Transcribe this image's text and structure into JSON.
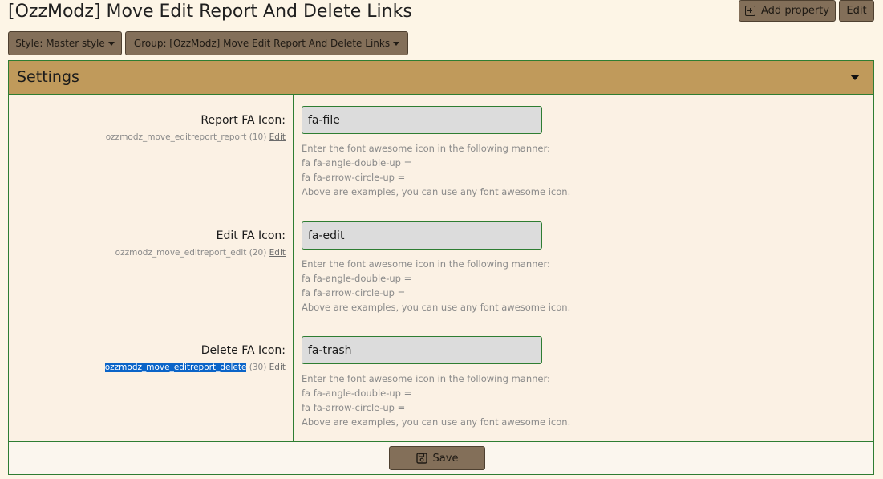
{
  "page": {
    "title": "[OzzModz] Move Edit Report And Delete Links"
  },
  "toolbar": {
    "add_property_label": "Add property",
    "add_property_icon": "plus-square-icon",
    "edit_label": "Edit"
  },
  "filters": {
    "style_label": "Style: Master style",
    "group_label": "Group: [OzzModz] Move Edit Report And Delete Links"
  },
  "panel": {
    "title": "Settings",
    "save_label": "Save",
    "save_icon": "floppy-disk-icon",
    "rows": [
      {
        "label": "Report FA Icon:",
        "var_name": "ozzmodz_move_editreport_report",
        "order": "(10)",
        "edit_link": "Edit",
        "value": "fa-file",
        "hint_lines": [
          "Enter the font awesome icon in the following manner:",
          "fa fa-angle-double-up =",
          "fa fa-arrow-circle-up =",
          "Above are examples, you can use any font awesome icon."
        ]
      },
      {
        "label": "Edit FA Icon:",
        "var_name": "ozzmodz_move_editreport_edit",
        "order": "(20)",
        "edit_link": "Edit",
        "value": "fa-edit",
        "hint_lines": [
          "Enter the font awesome icon in the following manner:",
          "fa fa-angle-double-up =",
          "fa fa-arrow-circle-up =",
          "Above are examples, you can use any font awesome icon."
        ]
      },
      {
        "label": "Delete FA Icon:",
        "var_name": "ozzmodz_move_editreport_delete",
        "order": "(30)",
        "edit_link": "Edit",
        "value": "fa-trash",
        "hint_lines": [
          "Enter the font awesome icon in the following manner:",
          "fa fa-angle-double-up =",
          "fa fa-arrow-circle-up =",
          "Above are examples, you can use any font awesome icon."
        ]
      }
    ]
  },
  "colors": {
    "page_bg": "#fdf5e6",
    "button_bg": "#836f59",
    "panel_header_bg": "#c09a5b",
    "border": "#2e7d32",
    "selection": "#0a64c8"
  }
}
